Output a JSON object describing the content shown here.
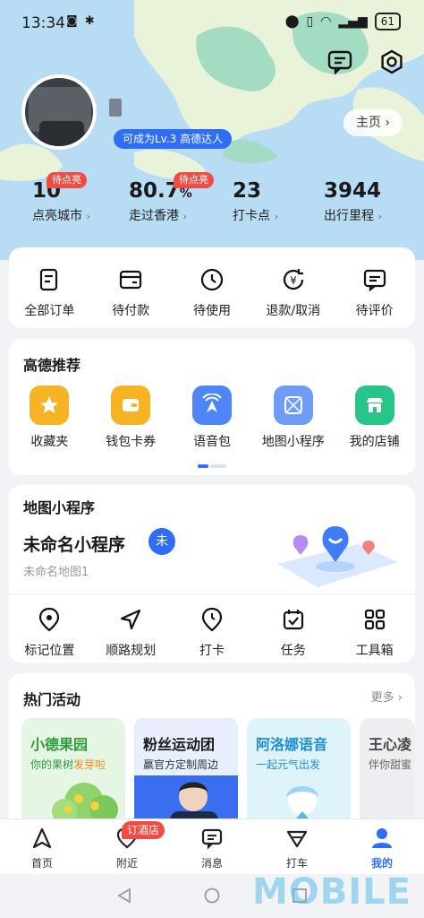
{
  "status_bar": {
    "time": "13:34",
    "battery": "61"
  },
  "profile": {
    "level_badge": "可成为Lv.3 高德达人",
    "home_button": "主页"
  },
  "stats": [
    {
      "value": "10",
      "unit": "",
      "label": "点亮城市",
      "tag": "待点亮"
    },
    {
      "value": "80.7",
      "unit": "%",
      "label": "走过香港",
      "tag": "待点亮"
    },
    {
      "value": "23",
      "unit": "",
      "label": "打卡点",
      "tag": ""
    },
    {
      "value": "3944",
      "unit": "",
      "label": "出行里程",
      "tag": ""
    }
  ],
  "orders": [
    {
      "label": "全部订单",
      "icon": "order-list-icon"
    },
    {
      "label": "待付款",
      "icon": "wallet-icon"
    },
    {
      "label": "待使用",
      "icon": "clock-icon"
    },
    {
      "label": "退款/取消",
      "icon": "refund-icon"
    },
    {
      "label": "待评价",
      "icon": "comment-icon"
    }
  ],
  "recommend": {
    "title": "高德推荐",
    "items": [
      {
        "label": "收藏夹",
        "icon": "star-icon",
        "color": "#f6b324"
      },
      {
        "label": "钱包卡券",
        "icon": "wallet-icon",
        "color": "#f6b324"
      },
      {
        "label": "语音包",
        "icon": "voice-icon",
        "color": "#4e86f7"
      },
      {
        "label": "地图小程序",
        "icon": "map-app-icon",
        "color": "#6f9cf8"
      },
      {
        "label": "我的店铺",
        "icon": "shop-icon",
        "color": "#27c58a"
      }
    ]
  },
  "mini_program": {
    "title": "地图小程序",
    "name": "未命名小程序",
    "badge": "未",
    "subtitle": "未命名地图1",
    "actions": [
      {
        "label": "标记位置",
        "icon": "location-pin-icon"
      },
      {
        "label": "顺路规划",
        "icon": "navigate-arrow-icon"
      },
      {
        "label": "打卡",
        "icon": "checkin-pin-icon"
      },
      {
        "label": "任务",
        "icon": "calendar-check-icon"
      },
      {
        "label": "工具箱",
        "icon": "grid-icon"
      }
    ]
  },
  "hot": {
    "title": "热门活动",
    "more": "更多",
    "cards": [
      {
        "title": "小德果园",
        "subtitle_a": "你的果树",
        "subtitle_b": "发芽啦",
        "bg": "#e6f6e4",
        "title_color": "#2f9a3a"
      },
      {
        "title": "粉丝运动团",
        "subtitle_a": "赢官方定制周边",
        "subtitle_b": "",
        "bg": "#3a6df0",
        "title_color": "#1a1a1a"
      },
      {
        "title": "阿洛娜语音",
        "subtitle_a": "一起元气出发",
        "subtitle_b": "",
        "bg": "#dff3fb",
        "title_color": "#1f8fd0"
      },
      {
        "title": "王心凌",
        "subtitle_a": "伴你甜蜜",
        "subtitle_b": "",
        "bg": "#eceef1",
        "title_color": "#444"
      }
    ]
  },
  "nav": {
    "items": [
      {
        "label": "首页",
        "icon": "home-arrow-icon"
      },
      {
        "label": "附近",
        "icon": "nearby-icon"
      },
      {
        "label": "消息",
        "icon": "message-icon"
      },
      {
        "label": "打车",
        "icon": "taxi-icon"
      },
      {
        "label": "我的",
        "icon": "profile-icon"
      }
    ],
    "hotel_badge": "订酒店"
  },
  "watermark": "MOBILE"
}
